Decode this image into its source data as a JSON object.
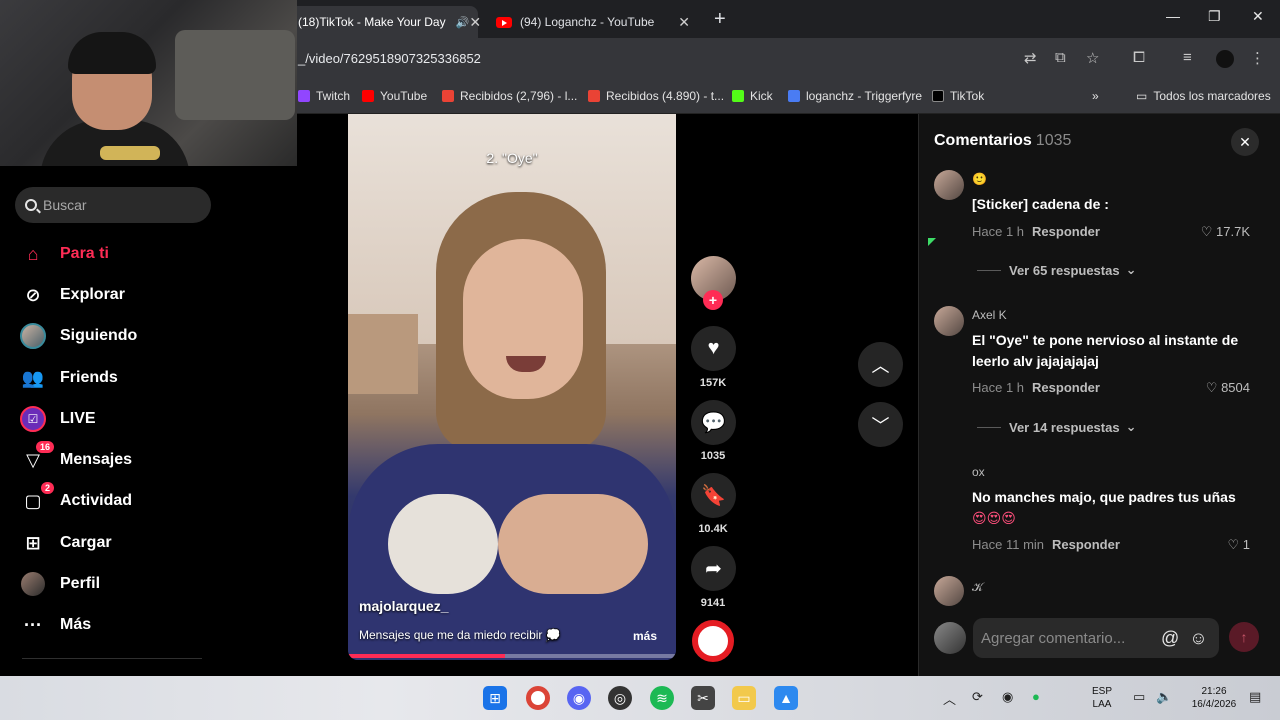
{
  "browser": {
    "tabs": [
      {
        "title": "(18)TikTok - Make Your Day",
        "active": true
      },
      {
        "title": "(94) Loganchz - YouTube",
        "active": false
      }
    ],
    "url": "_/video/7629518907325336852",
    "bookmarks": [
      {
        "label": "Twitch",
        "icon": "twitch-icon",
        "color": "#9146ff"
      },
      {
        "label": "YouTube",
        "icon": "youtube-icon",
        "color": "#ff0000"
      },
      {
        "label": "Recibidos (2,796) - l...",
        "icon": "gmail-icon",
        "color": "#ea4335"
      },
      {
        "label": "Recibidos (4.890) - t...",
        "icon": "gmail-icon",
        "color": "#ea4335"
      },
      {
        "label": "Kick",
        "icon": "kick-icon",
        "color": "#53fc18"
      },
      {
        "label": "loganchz - Triggerfyre",
        "icon": "triggerfyre-icon",
        "color": "#4a7cf3"
      },
      {
        "label": "TikTok",
        "icon": "tiktok-icon",
        "color": "#000000"
      }
    ],
    "all_bookmarks": "Todos los marcadores"
  },
  "sidebar": {
    "search_placeholder": "Buscar",
    "items": [
      {
        "label": "Para ti",
        "icon": "home-icon",
        "active": true
      },
      {
        "label": "Explorar",
        "icon": "compass-icon"
      },
      {
        "label": "Siguiendo",
        "icon": "following-avatar-icon"
      },
      {
        "label": "Friends",
        "icon": "friends-icon"
      },
      {
        "label": "LIVE",
        "icon": "live-icon"
      },
      {
        "label": "Mensajes",
        "icon": "messages-icon",
        "badge": "16"
      },
      {
        "label": "Actividad",
        "icon": "activity-icon",
        "badge": "2"
      },
      {
        "label": "Cargar",
        "icon": "upload-icon"
      },
      {
        "label": "Perfil",
        "icon": "profile-avatar-icon"
      },
      {
        "label": "Más",
        "icon": "more-icon"
      }
    ]
  },
  "video": {
    "caption": "2. \"Oye\"",
    "username": "majolarquez_",
    "description": "Mensajes que me da miedo recibir 💭",
    "more": "más",
    "progress": 0.48
  },
  "actions": {
    "likes": "157K",
    "comments": "1035",
    "saves": "10.4K",
    "shares": "9141"
  },
  "comments_panel": {
    "title": "Comentarios",
    "count": "1035",
    "comments": [
      {
        "name": "🙂",
        "text": "[Sticker] cadena de :",
        "time": "Hace 1 h",
        "reply": "Responder",
        "likes": "17.7K",
        "replies": "Ver 65 respuestas"
      },
      {
        "name": "Axel K",
        "text": "El \"Oye\" te pone nervioso al instante de leerlo alv jajajajajaj",
        "time": "Hace 1 h",
        "reply": "Responder",
        "likes": "8504",
        "replies": "Ver 14 respuestas"
      },
      {
        "name": "ox",
        "text": "No manches majo, que padres tus uñas",
        "emoji": "😍😍😍",
        "time": "Hace 11 min",
        "reply": "Responder",
        "likes": "1"
      },
      {
        "name": "𝒦"
      }
    ],
    "input_placeholder": "Agregar comentario..."
  },
  "taskbar": {
    "lang": "ESP",
    "lang_sub": "LAA",
    "time": "21:26",
    "date": "16/4/2026"
  }
}
